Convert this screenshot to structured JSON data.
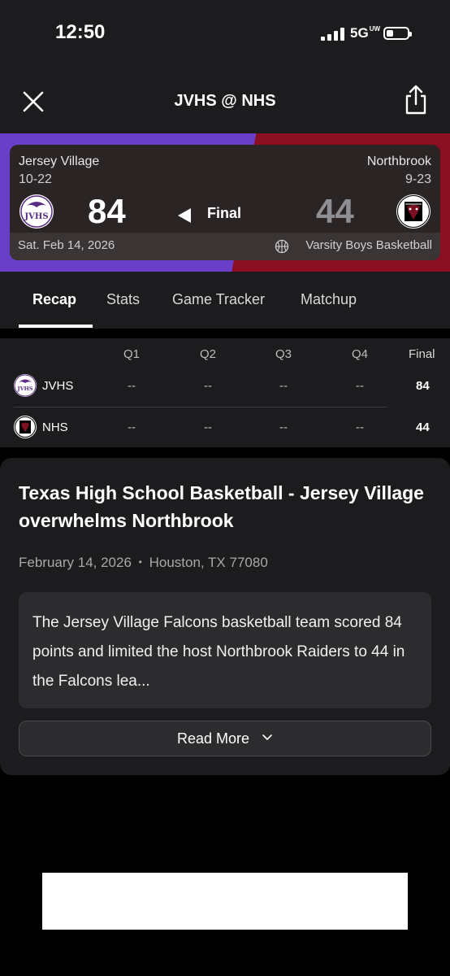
{
  "status_bar": {
    "time": "12:50",
    "network": "5G",
    "network_suffix": "UW",
    "battery_fraction": 0.35
  },
  "header": {
    "title": "JVHS @ NHS",
    "close_icon": "close-icon",
    "share_icon": "share-icon"
  },
  "game": {
    "home": {
      "name": "Jersey Village",
      "record": "10-22",
      "score": "84",
      "abbr": "JVHS",
      "color": "#6a3fc8"
    },
    "away": {
      "name": "Northbrook",
      "record": "9-23",
      "score": "44",
      "abbr": "NHS",
      "color": "#8a0f22"
    },
    "status": "Final",
    "date": "Sat. Feb 14, 2026",
    "type": "Varsity Boys Basketball"
  },
  "tabs": [
    {
      "label": "Recap",
      "active": true
    },
    {
      "label": "Stats",
      "active": false
    },
    {
      "label": "Game Tracker",
      "active": false
    },
    {
      "label": "Matchup",
      "active": false
    }
  ],
  "linescore": {
    "headers": [
      "Q1",
      "Q2",
      "Q3",
      "Q4",
      "Final"
    ],
    "rows": [
      {
        "team": "JVHS",
        "q": [
          "--",
          "--",
          "--",
          "--"
        ],
        "final": "84"
      },
      {
        "team": "NHS",
        "q": [
          "--",
          "--",
          "--",
          "--"
        ],
        "final": "44"
      }
    ]
  },
  "story": {
    "title": "Texas High School Basketball - Jersey Village overwhelms Northbrook",
    "date": "February 14, 2026",
    "separator": "•",
    "location": "Houston, TX 77080",
    "excerpt": "The Jersey Village Falcons basketball team scored 84 points and limited the host Northbrook Raiders to 44 in the Falcons lea...",
    "read_more": "Read More"
  }
}
